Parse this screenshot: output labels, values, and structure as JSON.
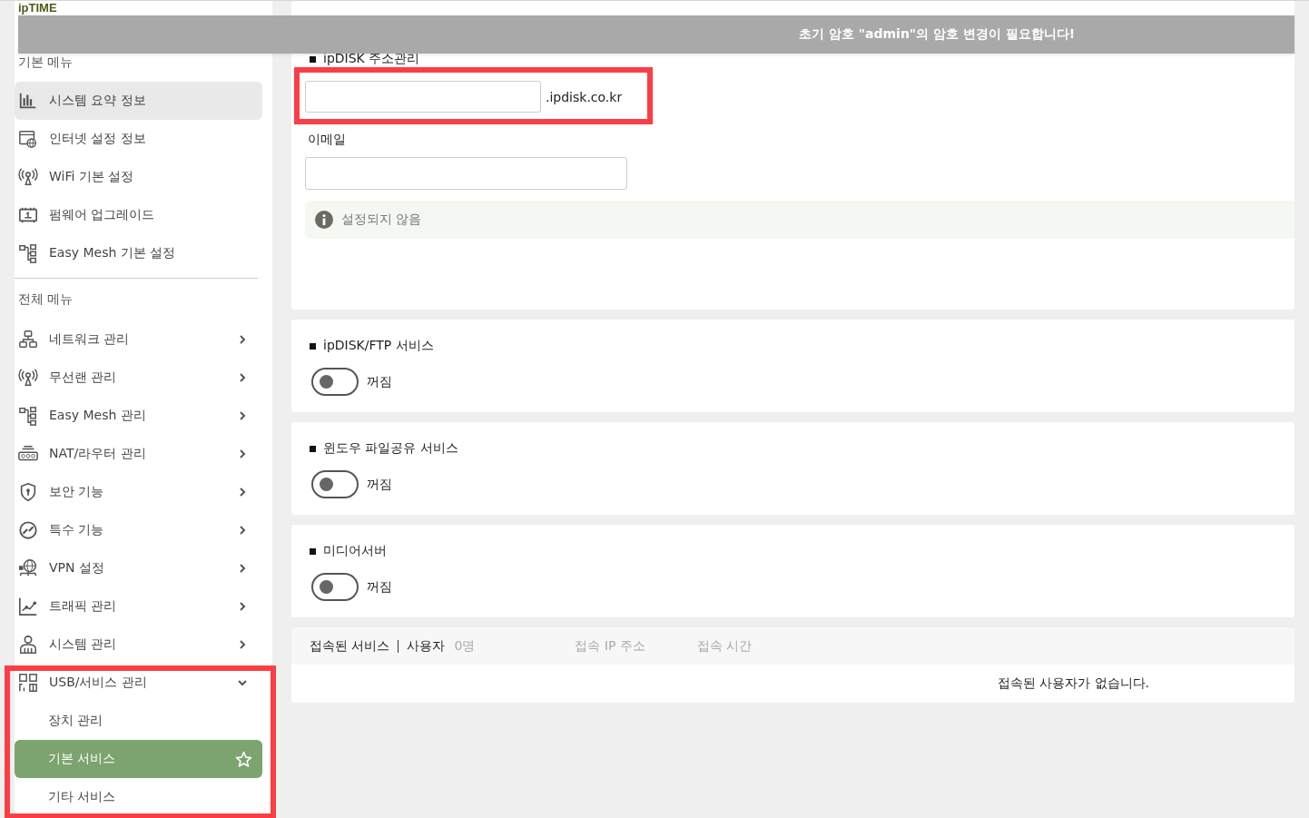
{
  "logo": "ipTIME",
  "banner": {
    "message": "초기 암호 \"admin\"의 암호 변경이 필요합니다!"
  },
  "sidebar": {
    "basic_menu": {
      "title": "기본 메뉴",
      "items": [
        {
          "label": "시스템 요약 정보",
          "hovered": true
        },
        {
          "label": "인터넷 설정 정보",
          "hovered": false
        },
        {
          "label": "WiFi 기본 설정",
          "hovered": false
        },
        {
          "label": "펌웨어 업그레이드",
          "hovered": false
        },
        {
          "label": "Easy Mesh 기본 설정",
          "hovered": false
        }
      ]
    },
    "full_menu": {
      "title": "전체 메뉴",
      "items": [
        {
          "label": "네트워크 관리",
          "expanded": false
        },
        {
          "label": "무선랜 관리",
          "expanded": false
        },
        {
          "label": "Easy Mesh 관리",
          "expanded": false
        },
        {
          "label": "NAT/라우터 관리",
          "expanded": false
        },
        {
          "label": "보안 기능",
          "expanded": false
        },
        {
          "label": "특수 기능",
          "expanded": false
        },
        {
          "label": "VPN 설정",
          "expanded": false
        },
        {
          "label": "트래픽 관리",
          "expanded": false
        },
        {
          "label": "시스템 관리",
          "expanded": false
        },
        {
          "label": "USB/서비스 관리",
          "expanded": true,
          "children": [
            {
              "label": "장치 관리",
              "selected": false
            },
            {
              "label": "기본 서비스",
              "selected": true
            },
            {
              "label": "기타 서비스",
              "selected": false
            }
          ]
        }
      ]
    }
  },
  "ipdisk_address": {
    "title": "ipDISK 주소관리",
    "suffix": ".ipdisk.co.kr",
    "email_label": "이메일",
    "status": "설정되지 않음"
  },
  "services": [
    {
      "title": "ipDISK/FTP 서비스",
      "on": false,
      "state_label": "꺼짐"
    },
    {
      "title": "윈도우 파일공유 서비스",
      "on": false,
      "state_label": "꺼짐"
    },
    {
      "title": "미디어서버",
      "on": false,
      "state_label": "꺼짐"
    }
  ],
  "connections": {
    "title": "접속된 서비스",
    "users_label": "사용자",
    "user_count": "0명",
    "columns": [
      "접속 IP 주소",
      "접속 시간"
    ],
    "empty_message": "접속된 사용자가 없습니다."
  }
}
